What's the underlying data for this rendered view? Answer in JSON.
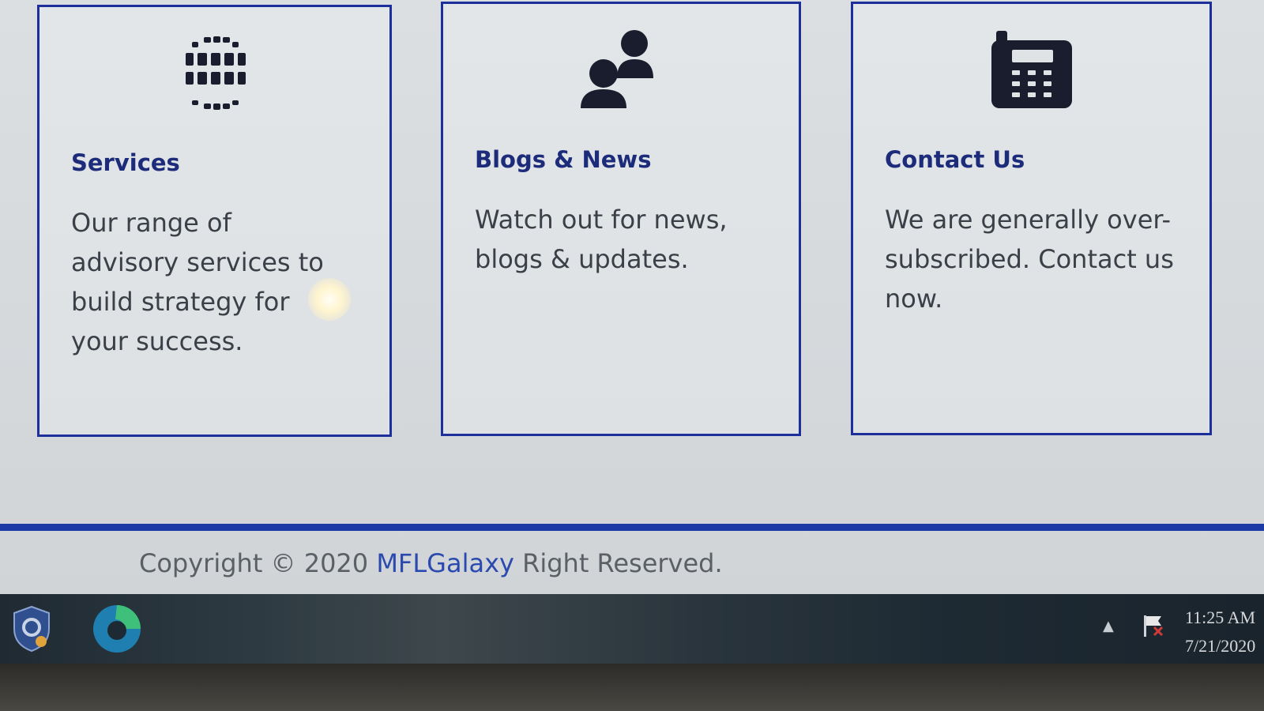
{
  "cards": {
    "services": {
      "title": "Services",
      "description": "Our range of advisory services to build strategy for your success.",
      "icon": "globe-icon"
    },
    "blogs": {
      "title": "Blogs & News",
      "description": "Watch out for news, blogs & updates.",
      "icon": "users-icon"
    },
    "contact": {
      "title": "Contact Us",
      "description": "We are generally over-subscribed. Contact us now.",
      "icon": "phone-icon"
    }
  },
  "footer": {
    "prefix": "Copyright © 2020 ",
    "brand": "MFLGalaxy",
    "suffix": " Right Reserved."
  },
  "taskbar": {
    "time": "11:25 AM",
    "date": "7/21/2020",
    "icons": [
      "shield-icon",
      "edge-icon",
      "show-hidden-icons-icon",
      "action-center-flag-icon"
    ]
  },
  "colors": {
    "accent": "#1c2f9a",
    "title": "#1d2c7a",
    "text": "#3b3f47",
    "footer_line": "#1b3aa5"
  }
}
